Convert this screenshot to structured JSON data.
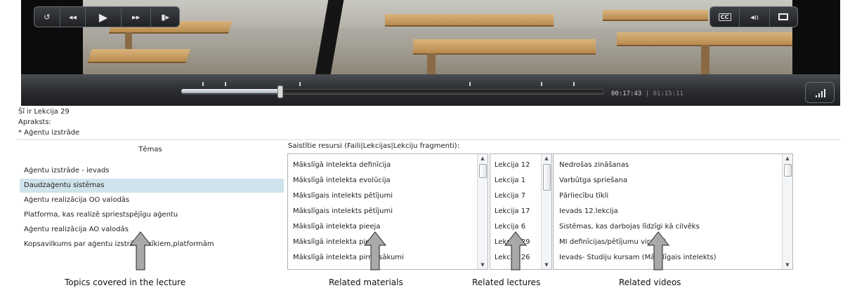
{
  "player": {
    "icons": {
      "replay": "replay-icon",
      "rewind": "rewind-icon",
      "play": "play-icon",
      "fast_forward": "fast-forward-icon",
      "next": "step-forward-icon",
      "captions": "cc-icon",
      "volume": "volume-icon",
      "fullscreen": "screen-icon",
      "signal": "signal-bars-icon"
    },
    "controls": {
      "captions_label": "CC"
    },
    "time_current": "00:17:43",
    "time_separator": "|",
    "time_total": "01:15:11",
    "progress": 0.234
  },
  "info": {
    "title": "Šī ir Lekcija 29",
    "desc_label": "Apraksts:",
    "desc_item": "* Aģentu izstrāde"
  },
  "topics": {
    "header": "Tēmas",
    "items": [
      "Aģentu izstrāde - ievads",
      "Daudzaģentu sistēmas",
      "Aģentu realizācija OO valodās",
      "Platforma, kas realizē spriestspējīgu aģentu",
      "Aģentu realizācija AO valodās",
      "Kopsavilkums par aģentu izstrādes rīkiem,platformām"
    ],
    "selected_index": 1
  },
  "resources": {
    "header": "Saistītie resursi (Faili|Lekcijas|Lekciju fragmenti):",
    "materials": [
      "Mākslīgā intelekta definīcija",
      "Mākslīgā intelekta evolūcija",
      "Mākslīgais intelekts pētījumi",
      "Mākslīgais intelekts pētījumi",
      "Mākslīgā intelekta pieeja",
      "Mākslīgā intelekta pieeja",
      "Mākslīgā intelekta pirmssākumi"
    ],
    "lectures": [
      "Lekcija 12",
      "Lekcija 1",
      "Lekcija 7",
      "Lekcija 17",
      "Lekcija 6",
      "Lekcija 29",
      "Lekcija 26"
    ],
    "videos": [
      "Nedrošas zināšanas",
      "Varbūtga spriešana",
      "Pārliecību tīkli",
      "Ievads 12.lekcija",
      "Sistēmas, kas darbojas līdzīgi kā cilvēks",
      "MI definīcijas/pētījumu virzieni",
      "Ievads- Studiju kursam (Mākslīgais intelekts)"
    ]
  },
  "captions": {
    "topics": "Topics covered in the lecture",
    "materials": "Related materials",
    "lectures": "Related lectures",
    "videos": "Related videos"
  },
  "colors": {
    "selected_row": "#cfe3ec",
    "control_bar": "#2b2d31",
    "arrow_fill": "#a9a9a9"
  }
}
